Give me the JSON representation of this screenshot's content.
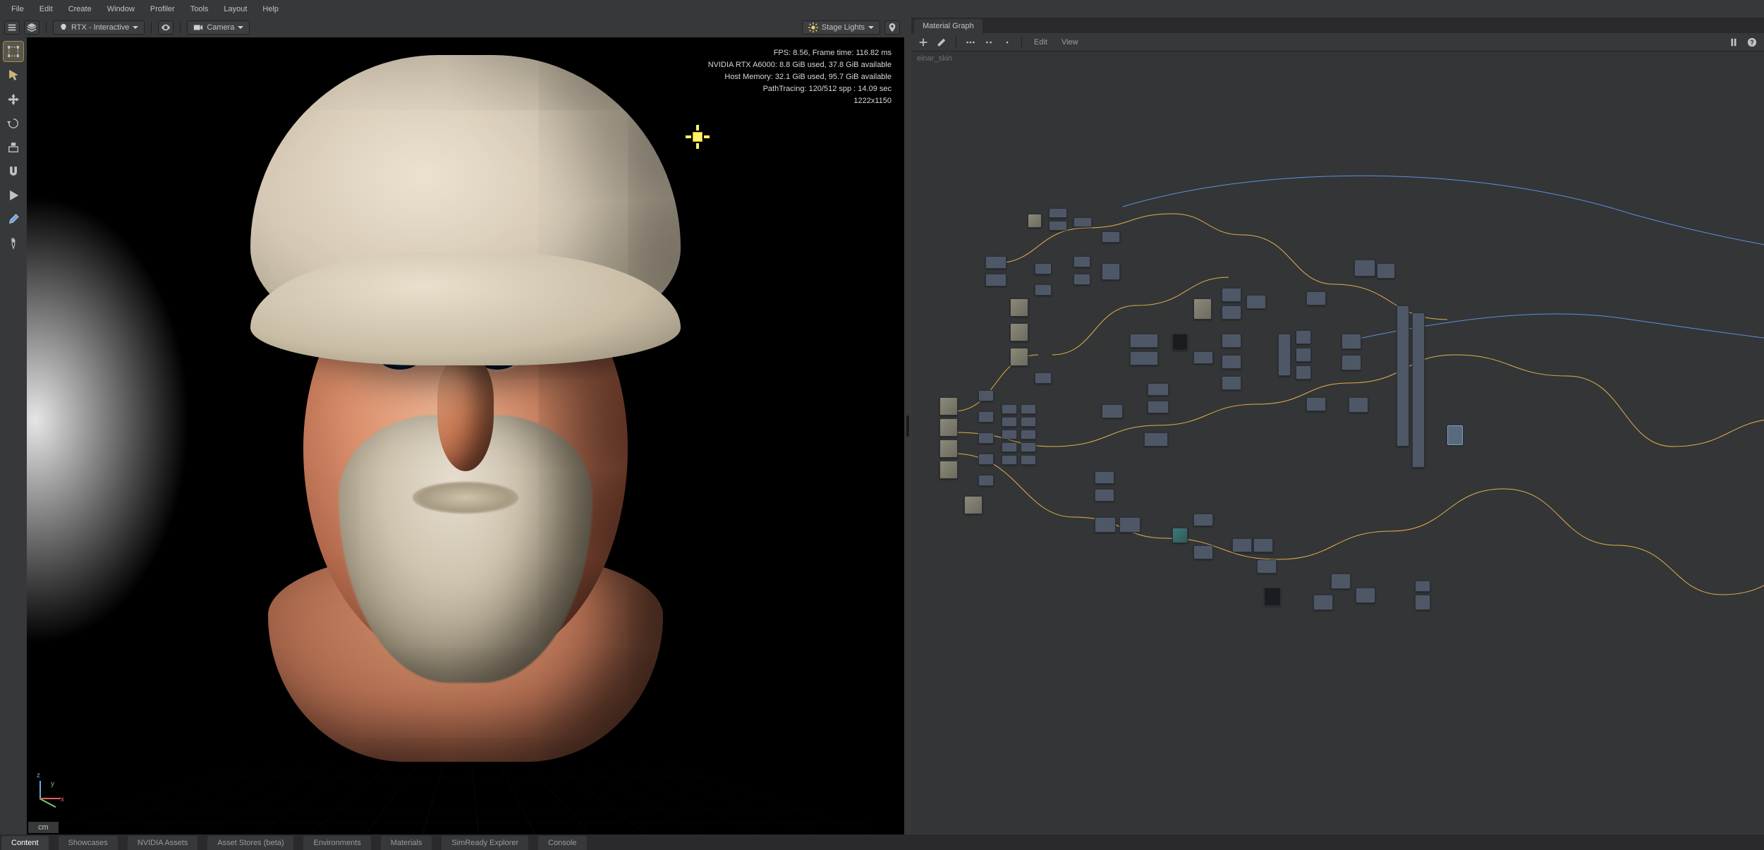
{
  "menu": {
    "items": [
      "File",
      "Edit",
      "Create",
      "Window",
      "Profiler",
      "Tools",
      "Layout",
      "Help"
    ]
  },
  "viewport": {
    "renderer_label": "RTX - Interactive",
    "camera_label": "Camera",
    "stage_lights_label": "Stage Lights",
    "units": "cm",
    "axis": {
      "x": "x",
      "y": "y",
      "z": "z"
    },
    "hud": {
      "line1": "FPS: 8.56, Frame time: 116.82 ms",
      "line2": "NVIDIA RTX A6000: 8.8 GiB used, 37.8 GiB available",
      "line3": "Host Memory: 32.1 GiB used, 95.7 GiB available",
      "line4": "PathTracing: 120/512 spp : 14.09 sec",
      "line5": "1222x1150"
    }
  },
  "material_graph": {
    "tab_label": "Material Graph",
    "material_name": "einar_skin",
    "menu": {
      "edit": "Edit",
      "view": "View"
    }
  },
  "bottom_tabs": [
    "Content",
    "Showcases",
    "NVIDIA Assets",
    "Asset Stores (beta)",
    "Environments",
    "Materials",
    "SimReady Explorer",
    "Console"
  ],
  "colors": {
    "wire_yellow": "#e0b04a",
    "wire_blue": "#5a91e0",
    "wire_green": "#5bb07a",
    "wire_orange": "#e07a3c",
    "wire_red": "#d85a5a"
  }
}
